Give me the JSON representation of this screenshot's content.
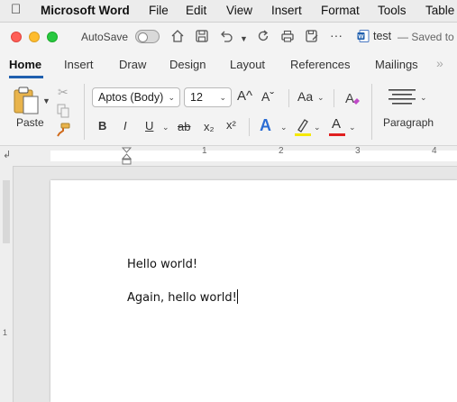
{
  "menubar": {
    "app_name": "Microsoft Word",
    "items": [
      "File",
      "Edit",
      "View",
      "Insert",
      "Format",
      "Tools",
      "Table"
    ]
  },
  "titlebar": {
    "autosave_label": "AutoSave",
    "autosave_on": false,
    "document_name": "test",
    "save_status": "— Saved to m"
  },
  "ribbon_tabs": [
    "Home",
    "Insert",
    "Draw",
    "Design",
    "Layout",
    "References",
    "Mailings"
  ],
  "active_tab": "Home",
  "ribbon": {
    "paste_label": "Paste",
    "font_name": "Aptos (Body)",
    "font_size": "12",
    "grow_font": "A^",
    "shrink_font": "Aˇ",
    "change_case": "Aa",
    "bold": "B",
    "italic": "I",
    "underline": "U",
    "strikethrough": "ab",
    "subscript": "x₂",
    "superscript": "x²",
    "text_effects": "A",
    "font_color": "A",
    "highlight_color": "#f5e800",
    "font_color_bar": "#e02020",
    "paragraph_label": "Paragraph"
  },
  "ruler": {
    "numbers": [
      "1",
      "2",
      "3",
      "4"
    ],
    "vertical_numbers": [
      "1"
    ]
  },
  "document": {
    "lines": [
      "Hello world!",
      "Again, hello world!"
    ]
  }
}
